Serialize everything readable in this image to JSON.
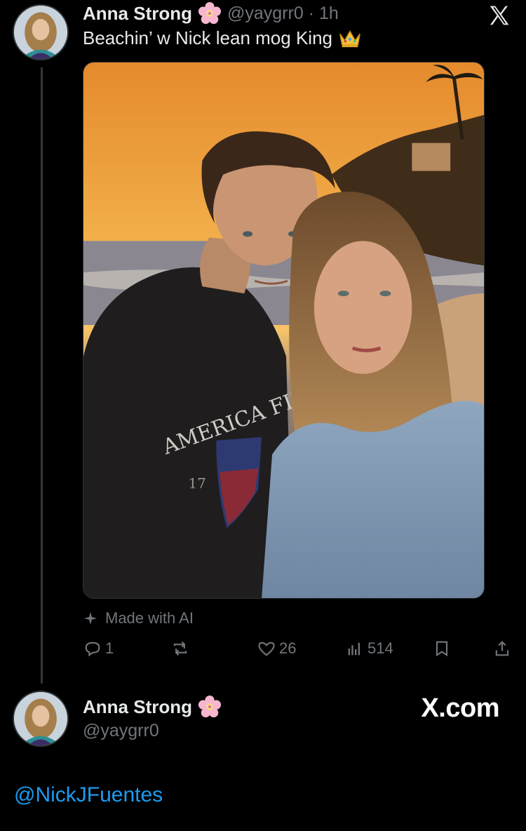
{
  "tweet": {
    "author_name": "Anna Strong",
    "author_emoji": "cherry-blossom-icon",
    "handle_time": "@yaygrr0 · 1h",
    "text": "Beachin’ w Nick lean  mog King",
    "text_emoji": "crown-icon",
    "photo_description_icon": "beach-couple-photo",
    "hoodie_text": "AMERICA FIRST",
    "hoodie_number": "17",
    "ai_label": "Made with AI",
    "replies": "1",
    "reposts": "",
    "likes": "26",
    "views": "514"
  },
  "profile": {
    "author_name": "Anna Strong",
    "handle": "@yaygrr0",
    "brand": "X.com",
    "mention": "@NickJFuentes"
  },
  "colors": {
    "background": "#000000",
    "text": "#e7e9ea",
    "muted": "#71767b",
    "link": "#1d9bf0",
    "thread_line": "#333639"
  }
}
